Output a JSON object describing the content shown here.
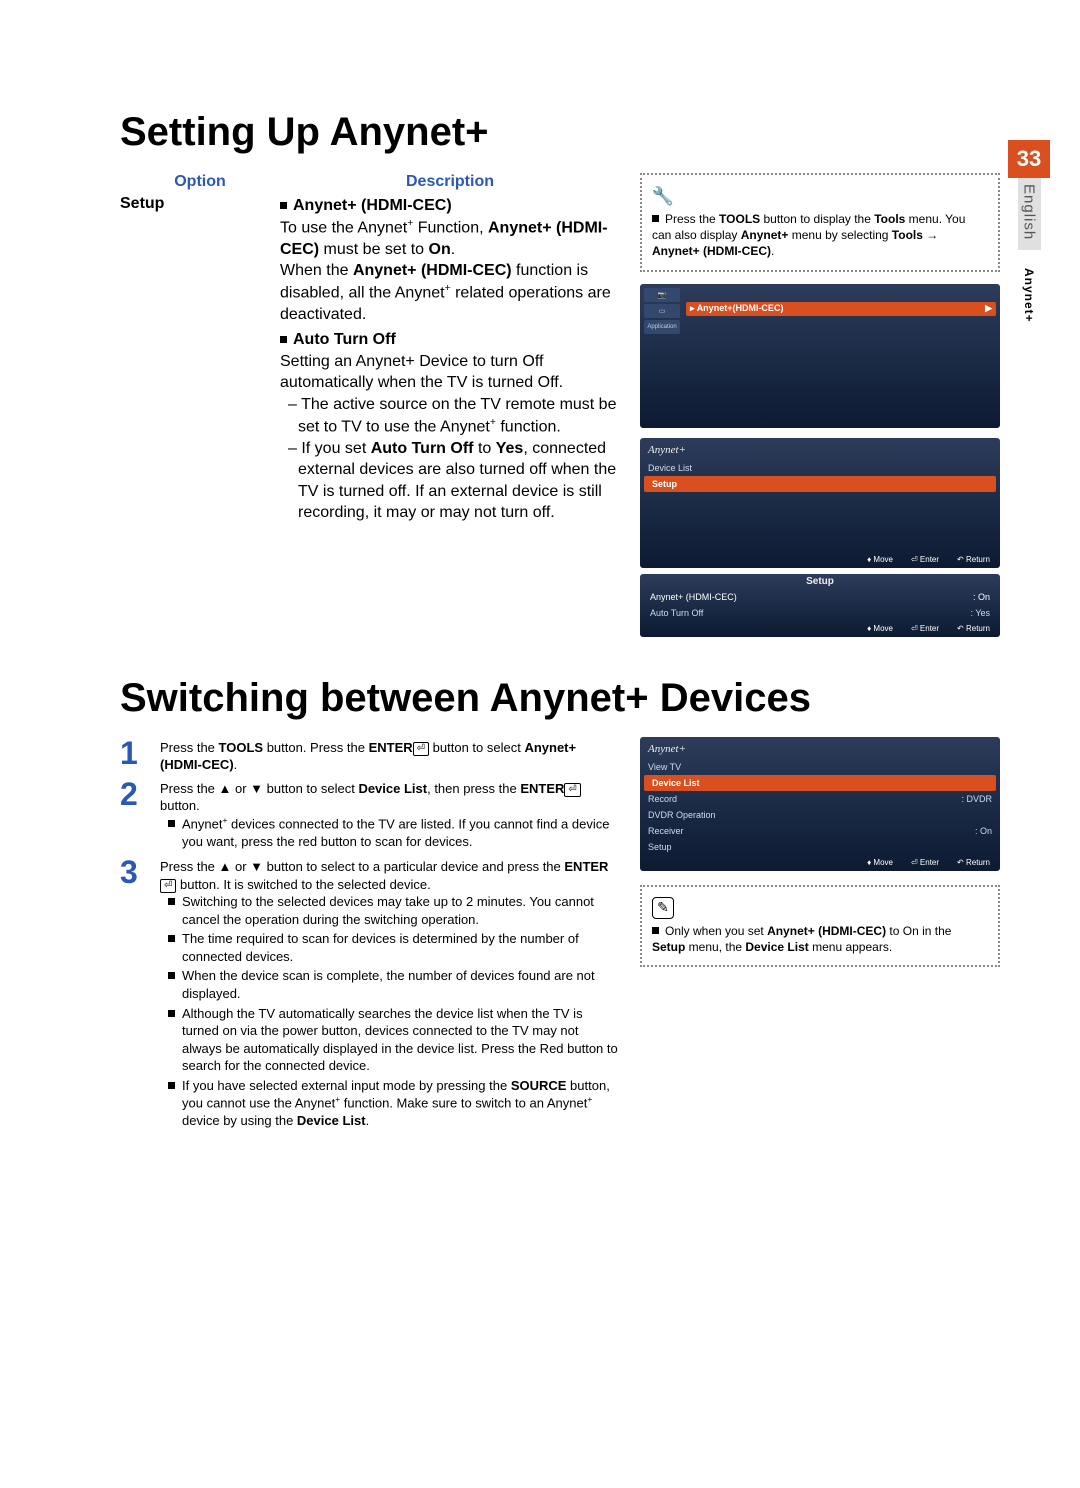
{
  "page_number": "33",
  "language_tab": "English",
  "section_tab": "Anynet+",
  "heading1": "Setting Up Anynet+",
  "table": {
    "header_option": "Option",
    "header_desc": "Description",
    "row_option": "Setup",
    "item1_title": "Anynet+ (HDMI-CEC)",
    "item1_p1a": "To use the Anynet",
    "item1_p1b": " Function, ",
    "item1_p1c": "Anynet+ (HDMI-CEC)",
    "item1_p1d": " must be set to ",
    "item1_p1e": "On",
    "item1_p1f": ".",
    "item1_p2a": "When the ",
    "item1_p2b": "Anynet+ (HDMI-CEC)",
    "item1_p2c": " function is disabled, all the Anynet",
    "item1_p2d": " related operations are deactivated.",
    "item2_title": "Auto Turn Off",
    "item2_p1": "Setting an Anynet+ Device to turn Off automatically when the TV is turned Off.",
    "item2_d1a": "The active source on the TV remote must be set to TV to use the Anynet",
    "item2_d1b": " function.",
    "item2_d2a": "If you set ",
    "item2_d2b": "Auto Turn Off",
    "item2_d2c": " to ",
    "item2_d2d": "Yes",
    "item2_d2e": ", connected external devices are also turned off when the TV is turned off. If an external device is still recording, it may or may not turn off."
  },
  "callout1": {
    "p1a": "Press the ",
    "p1b": "TOOLS",
    "p1c": " button to display the ",
    "p1d": "Tools",
    "p1e": " menu. You can also display ",
    "p1f": "Anynet+",
    "p1g": " menu by selecting ",
    "p1h": "Tools → Anynet+ (HDMI-CEC)",
    "p1i": "."
  },
  "osd1": {
    "sidebar_label": "Application",
    "sel_label": "Anynet+(HDMI-CEC)",
    "arrow": "▶"
  },
  "osd2": {
    "title": "Anynet+",
    "items": [
      "Device List",
      "Setup"
    ],
    "footer_move": "Move",
    "footer_enter": "Enter",
    "footer_return": "Return"
  },
  "osd3": {
    "title": "Setup",
    "row1_label": "Anynet+ (HDMI-CEC)",
    "row1_val": "On",
    "row2_label": "Auto Turn Off",
    "row2_val": "Yes",
    "footer_move": "Move",
    "footer_enter": "Enter",
    "footer_return": "Return"
  },
  "heading2": "Switching between Anynet+ Devices",
  "steps": {
    "s1a": "Press the ",
    "s1b": "TOOLS",
    "s1c": " button. Press the ",
    "s1d": "ENTER",
    "s1e": " button to select ",
    "s1f": "Anynet+ (HDMI-CEC)",
    "s1g": ".",
    "s2a": "Press the ▲ or ▼ button to select ",
    "s2b": "Device List",
    "s2c": ", then press the ",
    "s2d": "ENTER",
    "s2e": " button.",
    "s2_b1a": "Anynet",
    "s2_b1b": " devices connected to the TV are listed. If you cannot find a device you want, press the red button to scan for devices.",
    "s3a": "Press the ▲ or ▼ button to select to a particular device and press the ",
    "s3b": "ENTER",
    "s3c": " button. It is switched to the selected device.",
    "s3_b1": "Switching to the selected devices may take up to 2 minutes. You cannot cancel the operation during the switching operation.",
    "s3_b2": "The time required to scan for devices is determined by the number of connected devices.",
    "s3_b3": "When the device scan is complete, the number of devices found are not displayed.",
    "s3_b4": "Although the TV automatically searches the device list when the TV is turned on via the power button, devices connected to the TV may not always be automatically displayed in the device list. Press the Red button to search for the connected device.",
    "s3_b5a": "If you have selected external input mode by pressing the ",
    "s3_b5b": "SOURCE",
    "s3_b5c": " button, you cannot use the Anynet",
    "s3_b5d": " function. Make sure to switch to an Anynet",
    "s3_b5e": " device by using the ",
    "s3_b5f": "Device List",
    "s3_b5g": "."
  },
  "osd4": {
    "title": "Anynet+",
    "rows": [
      {
        "label": "View TV",
        "val": ""
      },
      {
        "label": "Device List",
        "val": ""
      },
      {
        "label": "Record",
        "val": "DVDR"
      },
      {
        "label": "DVDR Operation",
        "val": ""
      },
      {
        "label": "Receiver",
        "val": "On"
      },
      {
        "label": "Setup",
        "val": ""
      }
    ],
    "sel_index": 1,
    "footer_move": "Move",
    "footer_enter": "Enter",
    "footer_return": "Return"
  },
  "callout2": {
    "p1a": "Only when you set ",
    "p1b": "Anynet+ (HDMI-CEC)",
    "p1c": " to On in the ",
    "p1d": "Setup",
    "p1e": " menu, the ",
    "p1f": "Device List",
    "p1g": " menu appears."
  }
}
